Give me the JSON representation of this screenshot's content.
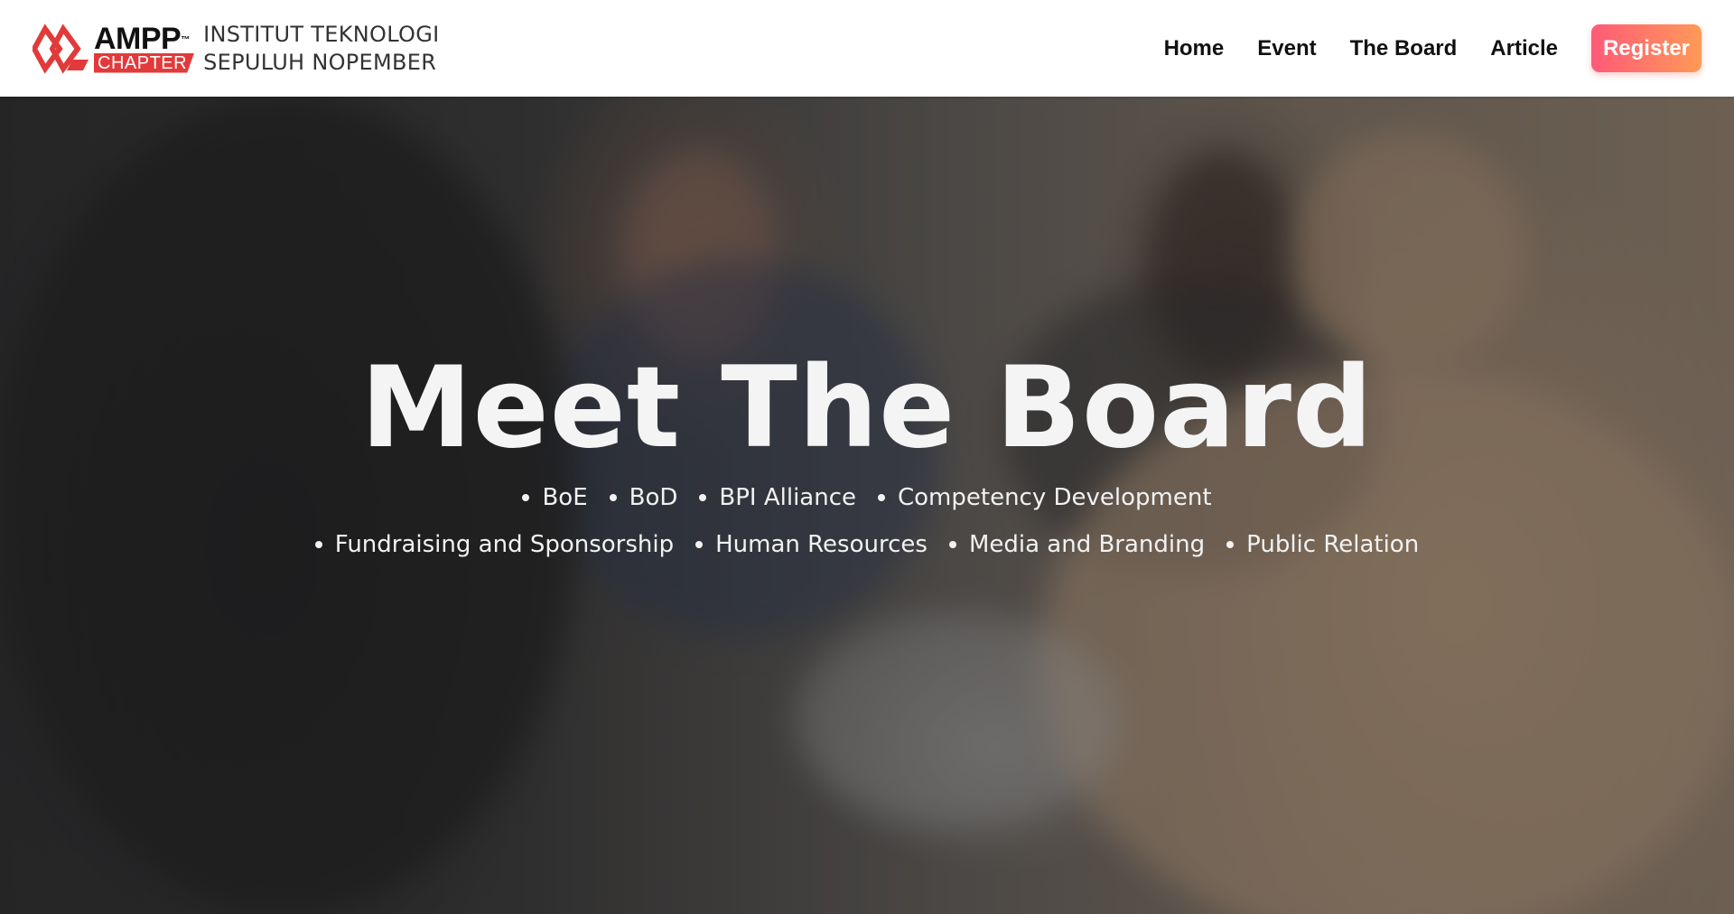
{
  "header": {
    "logo": {
      "ampp": "AMPP",
      "tm": "™",
      "chapter": "CHAPTER",
      "institution_line1": "INSTITUT TEKNOLOGI",
      "institution_line2": "SEPULUH NOPEMBER",
      "brand_red": "#e23a3a"
    },
    "nav": {
      "home": "Home",
      "event": "Event",
      "board": "The Board",
      "article": "Article",
      "register": "Register"
    },
    "register_gradient": [
      "#ff5a78",
      "#ff9a57"
    ]
  },
  "hero": {
    "title": "Meet The Board",
    "departments_row1": [
      "BoE",
      "BoD",
      "BPI Alliance",
      "Competency Development"
    ],
    "departments_row2": [
      "Fundraising and Sponsorship",
      "Human Resources",
      "Media and Branding",
      "Public Relation"
    ]
  }
}
